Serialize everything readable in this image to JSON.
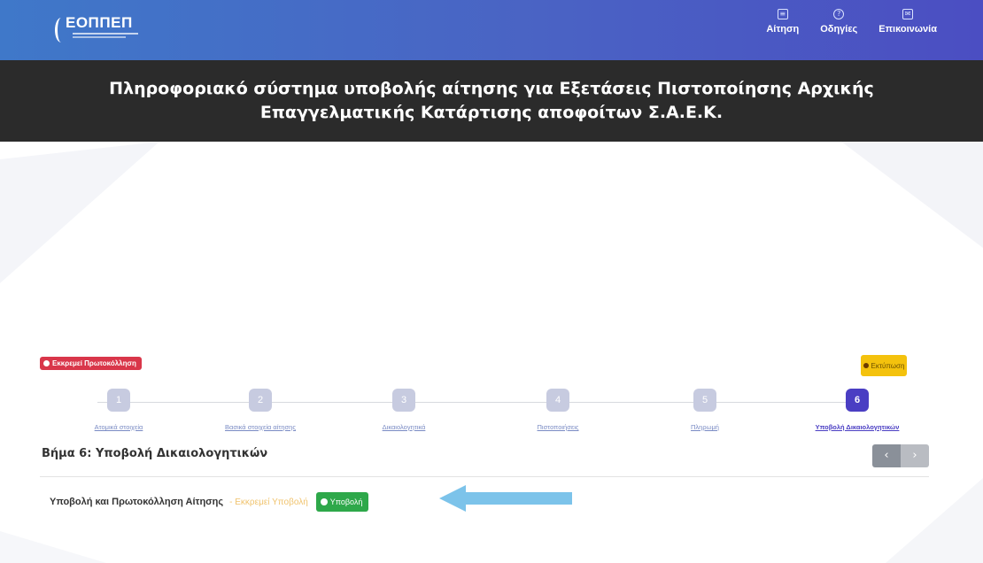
{
  "header": {
    "logo_text": "ΕΟΠΠΕΠ",
    "nav": [
      {
        "label": "Αίτηση",
        "icon": "document-icon"
      },
      {
        "label": "Οδηγίες",
        "icon": "help-icon"
      },
      {
        "label": "Επικοινωνία",
        "icon": "mail-icon"
      }
    ]
  },
  "banner": {
    "title": "Πληροφοριακό σύστημα υποβολής αίτησης για Εξετάσεις Πιστοποίησης Αρχικής Επαγγελματικής Κατάρτισης αποφοίτων Σ.Α.Ε.Κ."
  },
  "status": {
    "badge": "Εκκρεμεί Πρωτοκόλληση",
    "badge_color": "#d9364a",
    "print_label": "Εκτύπωση"
  },
  "stepper": {
    "steps": [
      {
        "number": "1",
        "label": "Ατομικά στοιχεία"
      },
      {
        "number": "2",
        "label": "Βασικά στοιχεία αίτησης"
      },
      {
        "number": "3",
        "label": "Δικαιολογητικά"
      },
      {
        "number": "4",
        "label": "Πιστοποιήσεις"
      },
      {
        "number": "5",
        "label": "Πληρωμή"
      },
      {
        "number": "6",
        "label": "Υποβολή Δικαιολογητικών"
      }
    ],
    "active_step": 6,
    "accent_color": "#4a3ec3"
  },
  "step_content": {
    "title": "Βήμα 6: Υποβολή Δικαιολογητικών",
    "prev_label": "‹",
    "next_label": "›",
    "submit_label": "Υποβολή και Πρωτοκόλληση Αίτησης",
    "submit_status": "- Εκκρεμεί Υποβολή",
    "submit_button": "Υποβολή"
  }
}
